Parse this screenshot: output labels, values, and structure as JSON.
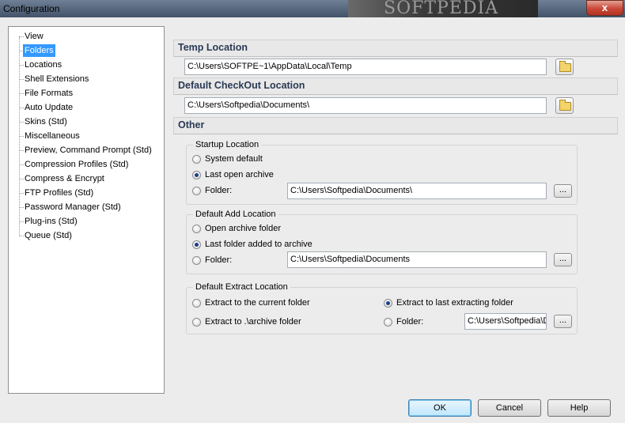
{
  "window": {
    "title": "Configuration",
    "close_label": "x",
    "watermark": "SOFTPEDIA"
  },
  "tree": {
    "items": [
      "View",
      "Folders",
      "Locations",
      "Shell Extensions",
      "File Formats",
      "Auto Update",
      "Skins (Std)",
      "Miscellaneous",
      "Preview, Command Prompt (Std)",
      "Compression Profiles (Std)",
      "Compress & Encrypt",
      "FTP Profiles (Std)",
      "Password Manager (Std)",
      "Plug-ins (Std)",
      "Queue (Std)"
    ],
    "selected": "Folders"
  },
  "temp_location": {
    "header": "Temp Location",
    "path": "C:\\Users\\SOFTPE~1\\AppData\\Local\\Temp"
  },
  "checkout_location": {
    "header": "Default CheckOut Location",
    "path": "C:\\Users\\Softpedia\\Documents\\"
  },
  "other": {
    "header": "Other",
    "startup": {
      "legend": "Startup Location",
      "opt_system": "System default",
      "opt_last": "Last open archive",
      "opt_folder": "Folder:",
      "folder_path": "C:\\Users\\Softpedia\\Documents\\",
      "selected": "Last open archive"
    },
    "add": {
      "legend": "Default Add Location",
      "opt_open": "Open archive folder",
      "opt_last": "Last folder added to archive",
      "opt_folder": "Folder:",
      "folder_path": "C:\\Users\\Softpedia\\Documents",
      "selected": "Last folder added to archive"
    },
    "extract": {
      "legend": "Default Extract Location",
      "opt_current": "Extract to the current folder",
      "opt_last": "Extract to last extracting folder",
      "opt_archive": "Extract to .\\archive folder",
      "opt_folder": "Folder:",
      "folder_path": "C:\\Users\\Softpedia\\D",
      "selected": "Extract to last extracting folder"
    }
  },
  "browse_label": "...",
  "buttons": {
    "ok": "OK",
    "cancel": "Cancel",
    "help": "Help"
  }
}
